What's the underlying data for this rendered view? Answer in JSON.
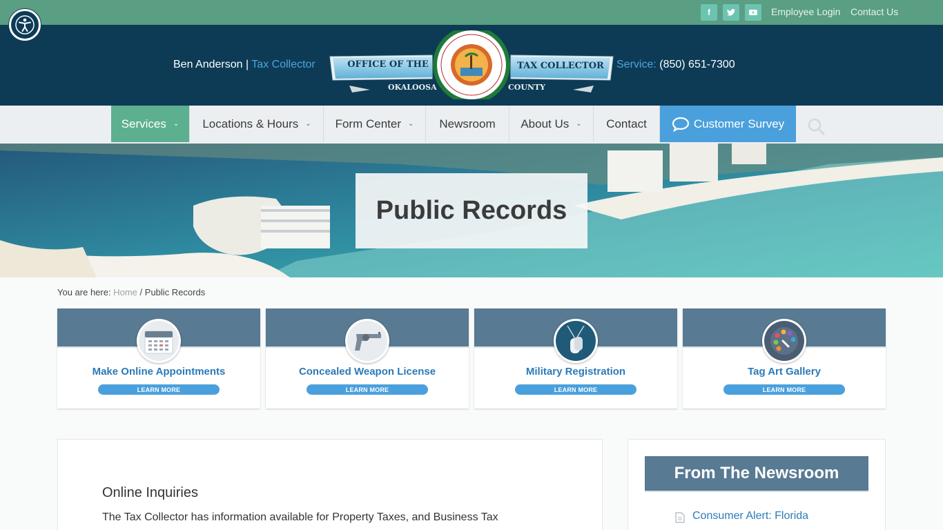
{
  "topbar": {
    "social": [
      {
        "icon": "facebook-icon",
        "glyph": "f"
      },
      {
        "icon": "twitter-icon",
        "glyph": "t"
      },
      {
        "icon": "youtube-icon",
        "glyph": "▶"
      }
    ],
    "links": [
      "Employee Login",
      "Contact Us"
    ]
  },
  "header": {
    "name": "Ben Anderson",
    "separator": "|",
    "role": "Tax Collector",
    "service_label": "Service:",
    "phone": "(850) 651-7300",
    "logo": {
      "left_banner": "OFFICE OF THE",
      "right_banner": "TAX COLLECTOR",
      "left_sub": "OKALOOSA",
      "right_sub": "COUNTY"
    }
  },
  "nav": {
    "items": [
      {
        "label": "Services",
        "chevron": "⌄"
      },
      {
        "label": "Locations & Hours",
        "chevron": "⌄"
      },
      {
        "label": "Form Center",
        "chevron": "⌄"
      },
      {
        "label": "Newsroom",
        "chevron": ""
      },
      {
        "label": "About Us",
        "chevron": "⌄"
      },
      {
        "label": "Contact",
        "chevron": ""
      }
    ],
    "survey": "Customer Survey"
  },
  "hero": {
    "title": "Public Records"
  },
  "breadcrumb": {
    "prefix": "You are here:",
    "home": "Home",
    "sep": "/",
    "current": "Public Records"
  },
  "cards": [
    {
      "title": "Make Online Appointments",
      "button": "LEARN MORE",
      "icon": "calendar-icon"
    },
    {
      "title": "Concealed Weapon License",
      "button": "LEARN MORE",
      "icon": "revolver-icon"
    },
    {
      "title": "Military Registration",
      "button": "LEARN MORE",
      "icon": "dog-tags-icon"
    },
    {
      "title": "Tag Art Gallery",
      "button": "LEARN MORE",
      "icon": "palette-icon"
    }
  ],
  "content": {
    "heading": "Online Inquiries",
    "text": "The Tax Collector has information available for Property Taxes, and Business Tax"
  },
  "sidebar": {
    "heading": "From The Newsroom",
    "items": [
      "Consumer Alert: Florida"
    ]
  },
  "colors": {
    "topbar": "#5a9e83",
    "header": "#0d3b56",
    "nav_active": "#5cb08f",
    "survey": "#4aa0dc",
    "card_top": "#587a93",
    "link": "#2b7ab8"
  }
}
